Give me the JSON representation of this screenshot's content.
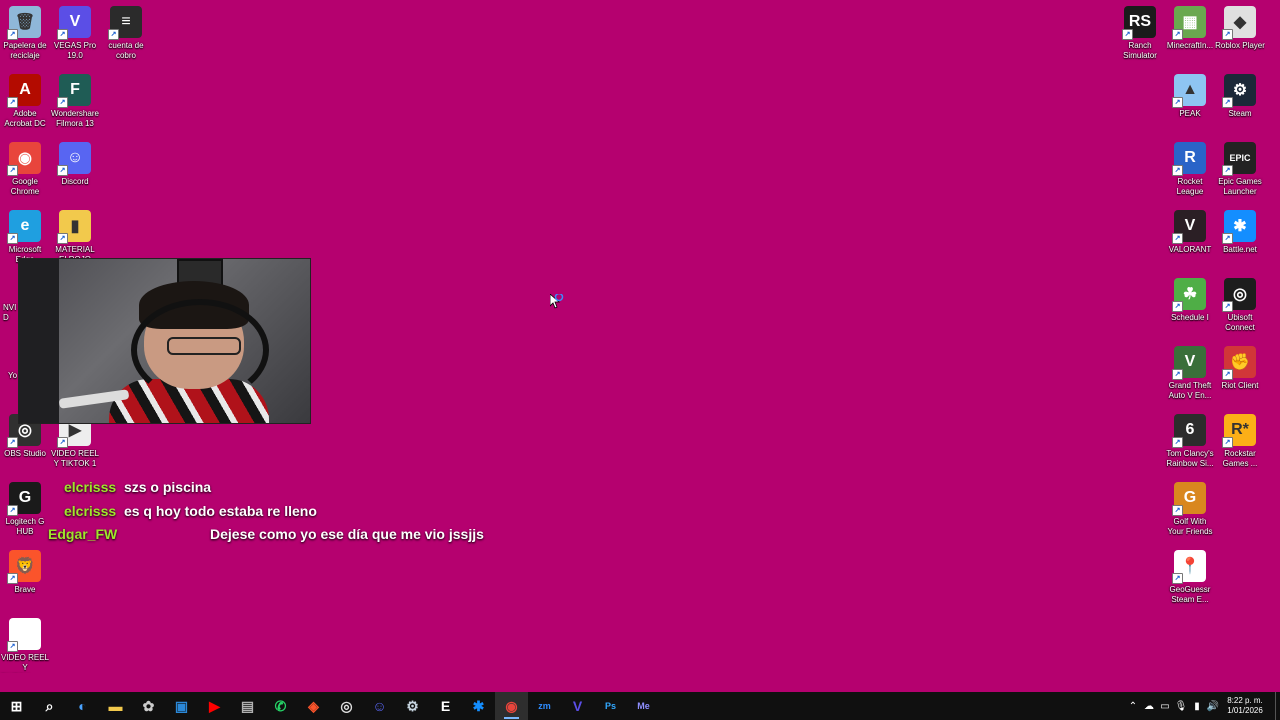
{
  "desktop": {
    "left_icons": [
      {
        "label": "Papelera de reciclaje",
        "icon": "recycle-bin-icon",
        "color": "#8fb7d8",
        "glyph": "🗑"
      },
      {
        "label": "VEGAS Pro 19.0",
        "icon": "vegas-pro-icon",
        "color": "#5b4ee6",
        "glyph": "V"
      },
      {
        "label": "cuenta de cobro",
        "icon": "document-icon",
        "color": "#2b2b2b",
        "glyph": "≡"
      },
      {
        "label": "Adobe Acrobat DC",
        "icon": "acrobat-icon",
        "color": "#b30b00",
        "glyph": "A"
      },
      {
        "label": "Wondershare Filmora 13",
        "icon": "filmora-icon",
        "color": "#1f5c55",
        "glyph": "F"
      },
      {
        "label": "Google Chrome",
        "icon": "chrome-icon",
        "color": "#e8453c",
        "glyph": "◉"
      },
      {
        "label": "Discord",
        "icon": "discord-icon",
        "color": "#5865f2",
        "glyph": "☺"
      },
      {
        "label": "Microsoft Edge",
        "icon": "edge-icon",
        "color": "#1f9fe0",
        "glyph": "e"
      },
      {
        "label": "MATERIAL ELROJO",
        "icon": "folder-icon",
        "color": "#f2c94c",
        "glyph": "▮"
      },
      {
        "label": "OBS Studio",
        "icon": "obs-icon",
        "color": "#303030",
        "glyph": "◎"
      },
      {
        "label": "VIDEO REEL Y TIKTOK 1",
        "icon": "video-file-icon",
        "color": "#eeeeee",
        "glyph": "▶"
      },
      {
        "label": "Logitech G HUB",
        "icon": "logitech-icon",
        "color": "#1a1a1a",
        "glyph": "G"
      },
      {
        "label": "Brave",
        "icon": "brave-icon",
        "color": "#fb542b",
        "glyph": "🦁"
      },
      {
        "label": "VIDEO REEL Y TIKTOK.veg...",
        "icon": "blank-file-icon",
        "color": "#ffffff",
        "glyph": ""
      }
    ],
    "partial_labels": [
      "NVID",
      "Yo"
    ],
    "right_icons": [
      {
        "label": "Ranch Simulator",
        "icon": "ranch-simulator-icon",
        "color": "#1b1b1b",
        "glyph": "RS"
      },
      {
        "label": "MinecraftIn...",
        "icon": "minecraft-icon",
        "color": "#6aa84f",
        "glyph": "▦"
      },
      {
        "label": "Roblox Player",
        "icon": "roblox-icon",
        "color": "#e0e0e0",
        "glyph": "◆"
      },
      {
        "label": "PEAK",
        "icon": "peak-icon",
        "color": "#8ec5f2",
        "glyph": "▲"
      },
      {
        "label": "Steam",
        "icon": "steam-icon",
        "color": "#1b2838",
        "glyph": "⚙"
      },
      {
        "label": "Rocket League",
        "icon": "rocket-league-icon",
        "color": "#2a64c8",
        "glyph": "R"
      },
      {
        "label": "Epic Games Launcher",
        "icon": "epic-games-icon",
        "color": "#222222",
        "glyph": "EPIC"
      },
      {
        "label": "VALORANT",
        "icon": "valorant-icon",
        "color": "#2b1f25",
        "glyph": "V"
      },
      {
        "label": "Battle.net",
        "icon": "battlenet-icon",
        "color": "#148eff",
        "glyph": "✱"
      },
      {
        "label": "Schedule I",
        "icon": "schedule-i-icon",
        "color": "#4fae46",
        "glyph": "☘"
      },
      {
        "label": "Ubisoft Connect",
        "icon": "ubisoft-icon",
        "color": "#1d1d1d",
        "glyph": "◎"
      },
      {
        "label": "Grand Theft Auto V En...",
        "icon": "gta-v-icon",
        "color": "#3a6f3a",
        "glyph": "V"
      },
      {
        "label": "Riot Client",
        "icon": "riot-icon",
        "color": "#d13639",
        "glyph": "✊"
      },
      {
        "label": "Tom Clancy's Rainbow Si...",
        "icon": "rainbow-six-icon",
        "color": "#2c2c2c",
        "glyph": "6"
      },
      {
        "label": "Rockstar Games ...",
        "icon": "rockstar-icon",
        "color": "#fcaf17",
        "glyph": "R*"
      },
      {
        "label": "Golf With Your Friends",
        "icon": "golf-icon",
        "color": "#d9871f",
        "glyph": "G"
      },
      {
        "label": "GeoGuessr Steam E...",
        "icon": "geoguessr-icon",
        "color": "#ffffff",
        "glyph": "📍"
      }
    ]
  },
  "chat": [
    {
      "user": "elcrisss",
      "message": "szs o piscina"
    },
    {
      "user": "elcrisss",
      "message": "es q hoy todo estaba re lleno"
    },
    {
      "user": "Edgar_FW",
      "message": "Dejese como yo ese día que me vio jssjjs"
    }
  ],
  "taskbar": {
    "apps": [
      {
        "name": "start-button",
        "glyph": "⊞",
        "color": "#ffffff"
      },
      {
        "name": "search-icon",
        "glyph": "⌕",
        "color": "#ffffff"
      },
      {
        "name": "copilot-icon",
        "glyph": "◐",
        "color": "#4aa3ff"
      },
      {
        "name": "file-explorer-icon",
        "glyph": "▬",
        "color": "#f2c94c"
      },
      {
        "name": "chatgpt-icon",
        "glyph": "✿",
        "color": "#cccccc"
      },
      {
        "name": "store-icon",
        "glyph": "▣",
        "color": "#2b88d8"
      },
      {
        "name": "youtube-icon",
        "glyph": "▶",
        "color": "#ff0000"
      },
      {
        "name": "generic-app-icon",
        "glyph": "▤",
        "color": "#b0b0b0"
      },
      {
        "name": "whatsapp-icon",
        "glyph": "✆",
        "color": "#25d366"
      },
      {
        "name": "brave-icon",
        "glyph": "◈",
        "color": "#fb542b"
      },
      {
        "name": "obs-icon",
        "glyph": "◎",
        "color": "#dddddd"
      },
      {
        "name": "discord-icon",
        "glyph": "☺",
        "color": "#5865f2"
      },
      {
        "name": "steam-icon",
        "glyph": "⚙",
        "color": "#c7d5e0"
      },
      {
        "name": "epic-games-icon",
        "glyph": "E",
        "color": "#ffffff"
      },
      {
        "name": "battlenet-icon",
        "glyph": "✱",
        "color": "#148eff"
      },
      {
        "name": "chrome-icon",
        "glyph": "◉",
        "color": "#e8453c"
      },
      {
        "name": "zoom-icon",
        "glyph": "zm",
        "color": "#2d8cff"
      },
      {
        "name": "vegas-pro-icon",
        "glyph": "V",
        "color": "#5b4ee6"
      },
      {
        "name": "photoshop-icon",
        "glyph": "Ps",
        "color": "#31a8ff"
      },
      {
        "name": "media-encoder-icon",
        "glyph": "Me",
        "color": "#8f8fff"
      }
    ],
    "active_app": "chrome-icon",
    "tray": {
      "time": "8:22 p. m.",
      "date": "1/01/2026"
    }
  }
}
